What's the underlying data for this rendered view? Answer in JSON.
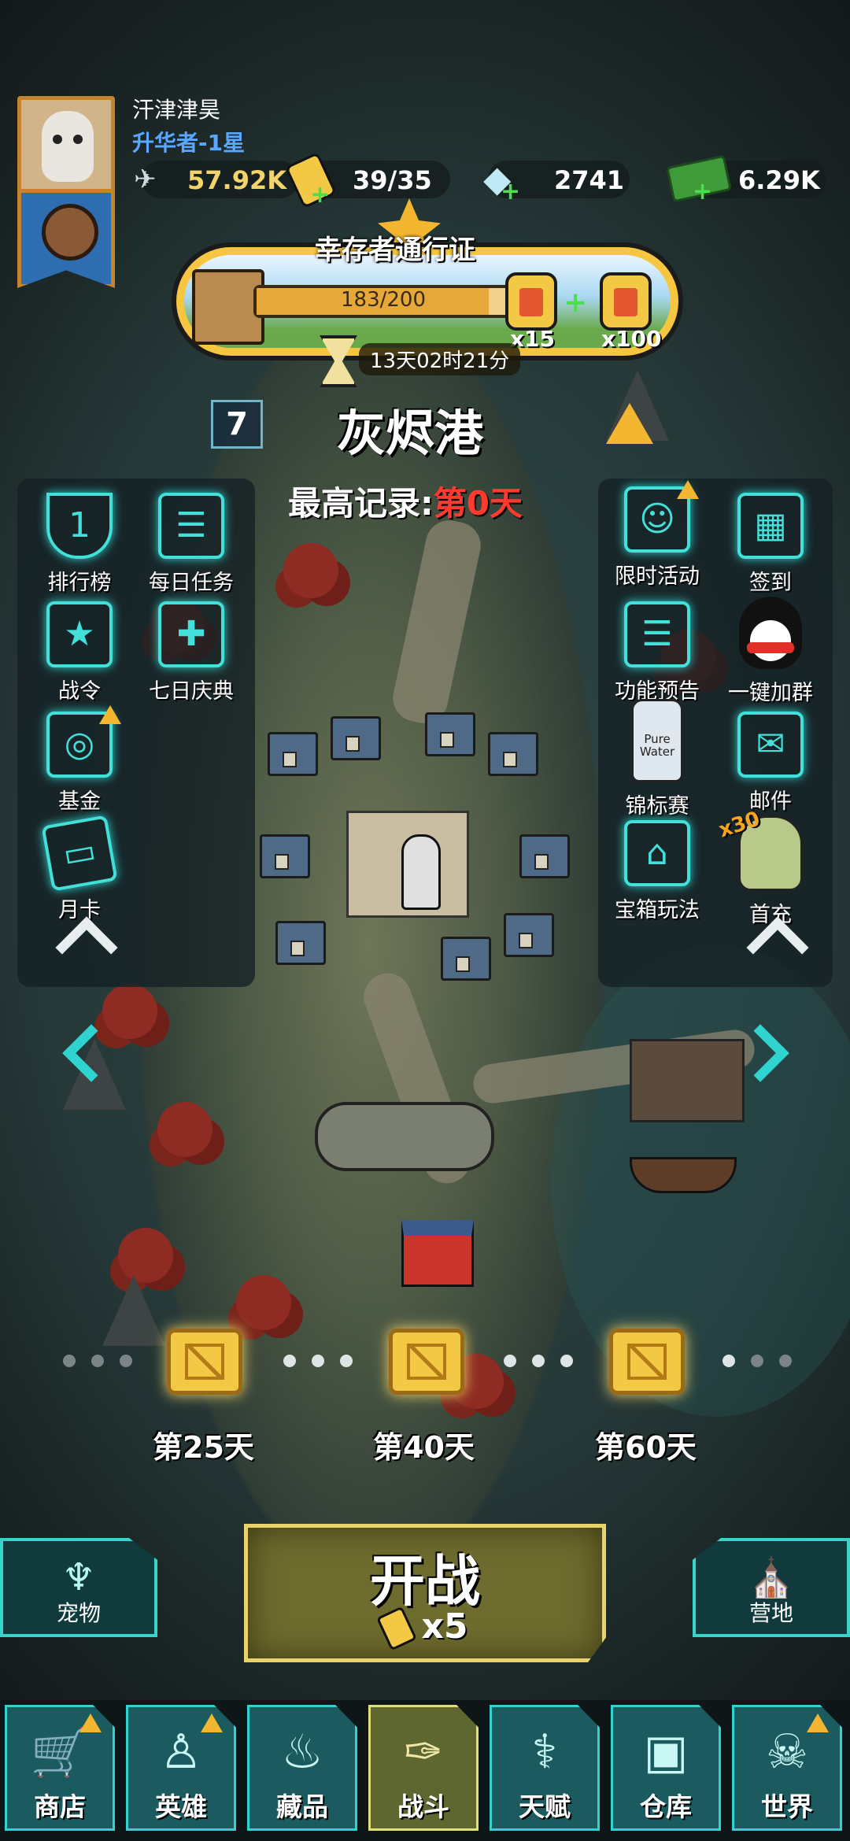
{
  "player": {
    "name": "汗津津昊",
    "rank": "升华者-1星"
  },
  "resources": {
    "power": "57.92K",
    "energy": "39/35",
    "diamonds": "2741",
    "cash": "6.29K"
  },
  "battle_pass": {
    "title": "幸存者通行证",
    "progress_text": "183/200",
    "progress": 0.915,
    "reward_1_mult": "x15",
    "reward_2_mult": "x100",
    "timer": "13天02时21分"
  },
  "stage": {
    "level": "7",
    "name": "灰烬港",
    "record_label": "最高记录:",
    "record_value": "第0天"
  },
  "left_features": [
    {
      "label": "排行榜",
      "icon": "trophy-icon"
    },
    {
      "label": "每日任务",
      "icon": "task-list-icon"
    },
    {
      "label": "战令",
      "icon": "banner-icon"
    },
    {
      "label": "七日庆典",
      "icon": "gift-icon"
    },
    {
      "label": "基金",
      "icon": "safe-icon"
    },
    {
      "label": "月卡",
      "icon": "ticket-icon"
    }
  ],
  "right_features": [
    {
      "label": "限时活动",
      "icon": "event-icon"
    },
    {
      "label": "签到",
      "icon": "calendar-icon"
    },
    {
      "label": "功能预告",
      "icon": "preview-icon"
    },
    {
      "label": "一键加群",
      "icon": "penguin-icon"
    },
    {
      "label": "锦标赛",
      "icon": "water-bottle-icon"
    },
    {
      "label": "邮件",
      "icon": "mail-icon"
    },
    {
      "label": "宝箱玩法",
      "icon": "chest-icon"
    },
    {
      "label": "首充",
      "icon": "zombie-icon"
    }
  ],
  "first_charge_badge": "x30",
  "water_bottle_text": "Pure Water",
  "milestones": [
    {
      "label": "第25天"
    },
    {
      "label": "第40天"
    },
    {
      "label": "第60天"
    }
  ],
  "actions": {
    "pet": "宠物",
    "fight": "开战",
    "fight_cost": "x5",
    "camp": "营地"
  },
  "nav": [
    {
      "label": "商店",
      "icon": "cart-icon"
    },
    {
      "label": "英雄",
      "icon": "hero-icon"
    },
    {
      "label": "藏品",
      "icon": "flame-icon"
    },
    {
      "label": "战斗",
      "icon": "rifle-icon"
    },
    {
      "label": "天赋",
      "icon": "dna-icon"
    },
    {
      "label": "仓库",
      "icon": "box-icon"
    },
    {
      "label": "世界",
      "icon": "demon-icon"
    }
  ],
  "colors": {
    "accent": "#2fd4d0",
    "gold": "#f2c845",
    "record_red": "#ff3b30",
    "rank_blue": "#5aa7ff"
  }
}
